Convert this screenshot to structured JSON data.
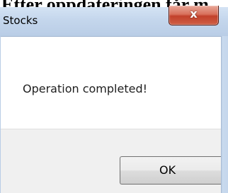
{
  "background": {
    "heading_text": "Etter oppdateringen får m"
  },
  "dialog": {
    "title": "Stocks",
    "close_icon_glyph": "x",
    "message": "Operation completed!",
    "ok_label": "OK"
  },
  "colors": {
    "close_button": "#c2412b",
    "titlebar": "#c4d6ec",
    "footer": "#f0f0f0"
  }
}
